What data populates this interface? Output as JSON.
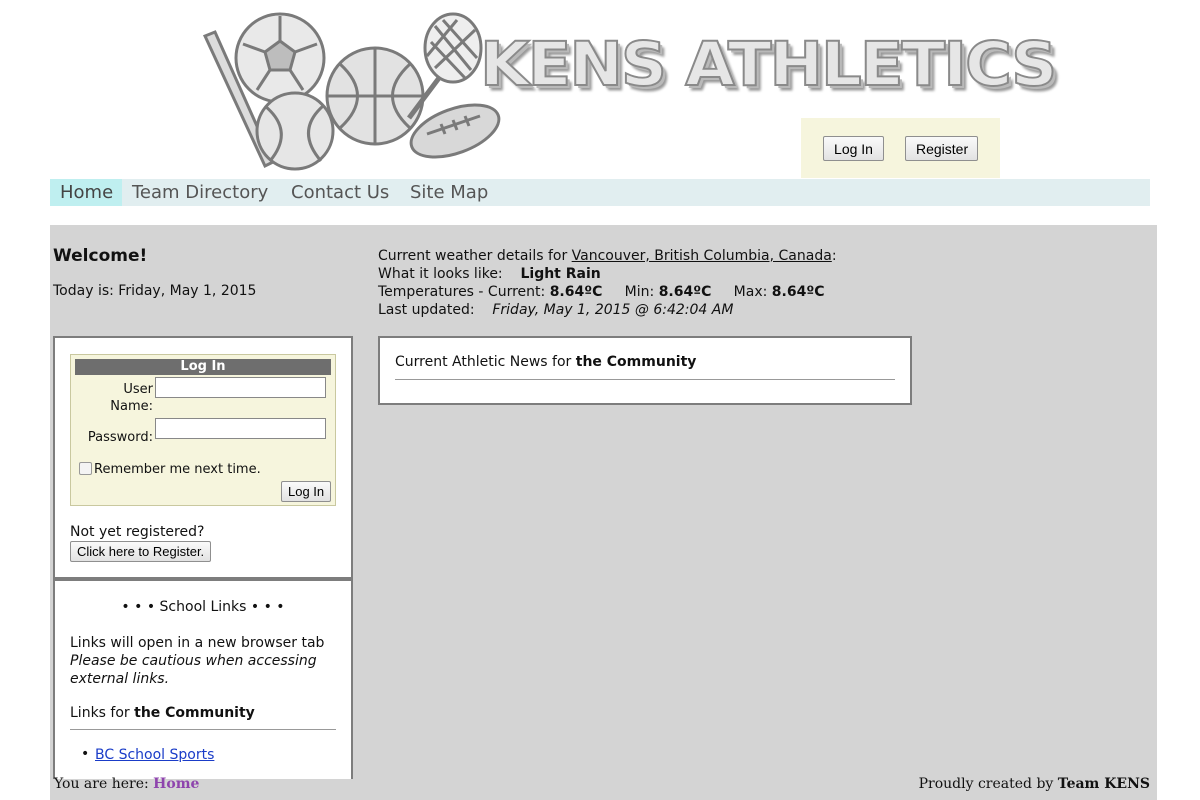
{
  "header": {
    "brand": "KENS ATHLETICS",
    "login_button": "Log In",
    "register_button": "Register"
  },
  "nav": {
    "items": [
      {
        "label": "Home"
      },
      {
        "label": "Team Directory"
      },
      {
        "label": "Contact Us"
      },
      {
        "label": "Site Map"
      }
    ]
  },
  "welcome": {
    "title": "Welcome!",
    "today": "Today is: Friday, May 1, 2015"
  },
  "weather": {
    "intro": "Current weather details for ",
    "location": "Vancouver, British Columbia, Canada",
    "looks_label": "What it looks like:",
    "looks_value": "Light Rain",
    "temps_label": "Temperatures - Current: ",
    "current": "8.64ºC",
    "min_label": "Min: ",
    "min": "8.64ºC",
    "max_label": "Max: ",
    "max": "8.64ºC",
    "updated_label": "Last updated:",
    "updated_value": "Friday, May 1, 2015 @ 6:42:04 AM"
  },
  "login": {
    "title": "Log In",
    "username_label_1": "User",
    "username_label_2": "Name:",
    "password_label": "Password:",
    "remember": "Remember me next time.",
    "submit": "Log In",
    "not_registered": "Not yet registered?",
    "register_link": "Click here to Register."
  },
  "links": {
    "title": "• • • School Links • • •",
    "note1": "Links will open in a new browser tab",
    "note2": "Please be cautious when accessing external links.",
    "heading_prefix": "Links for ",
    "heading_bold": "the Community",
    "items": [
      {
        "label": "BC School Sports"
      }
    ]
  },
  "news": {
    "title_prefix": "Current Athletic News for ",
    "title_bold": "the Community"
  },
  "footer": {
    "here_label": "You are here: ",
    "here_value": "Home",
    "credit_prefix": "Proudly created by ",
    "credit_bold": "Team KENS"
  }
}
